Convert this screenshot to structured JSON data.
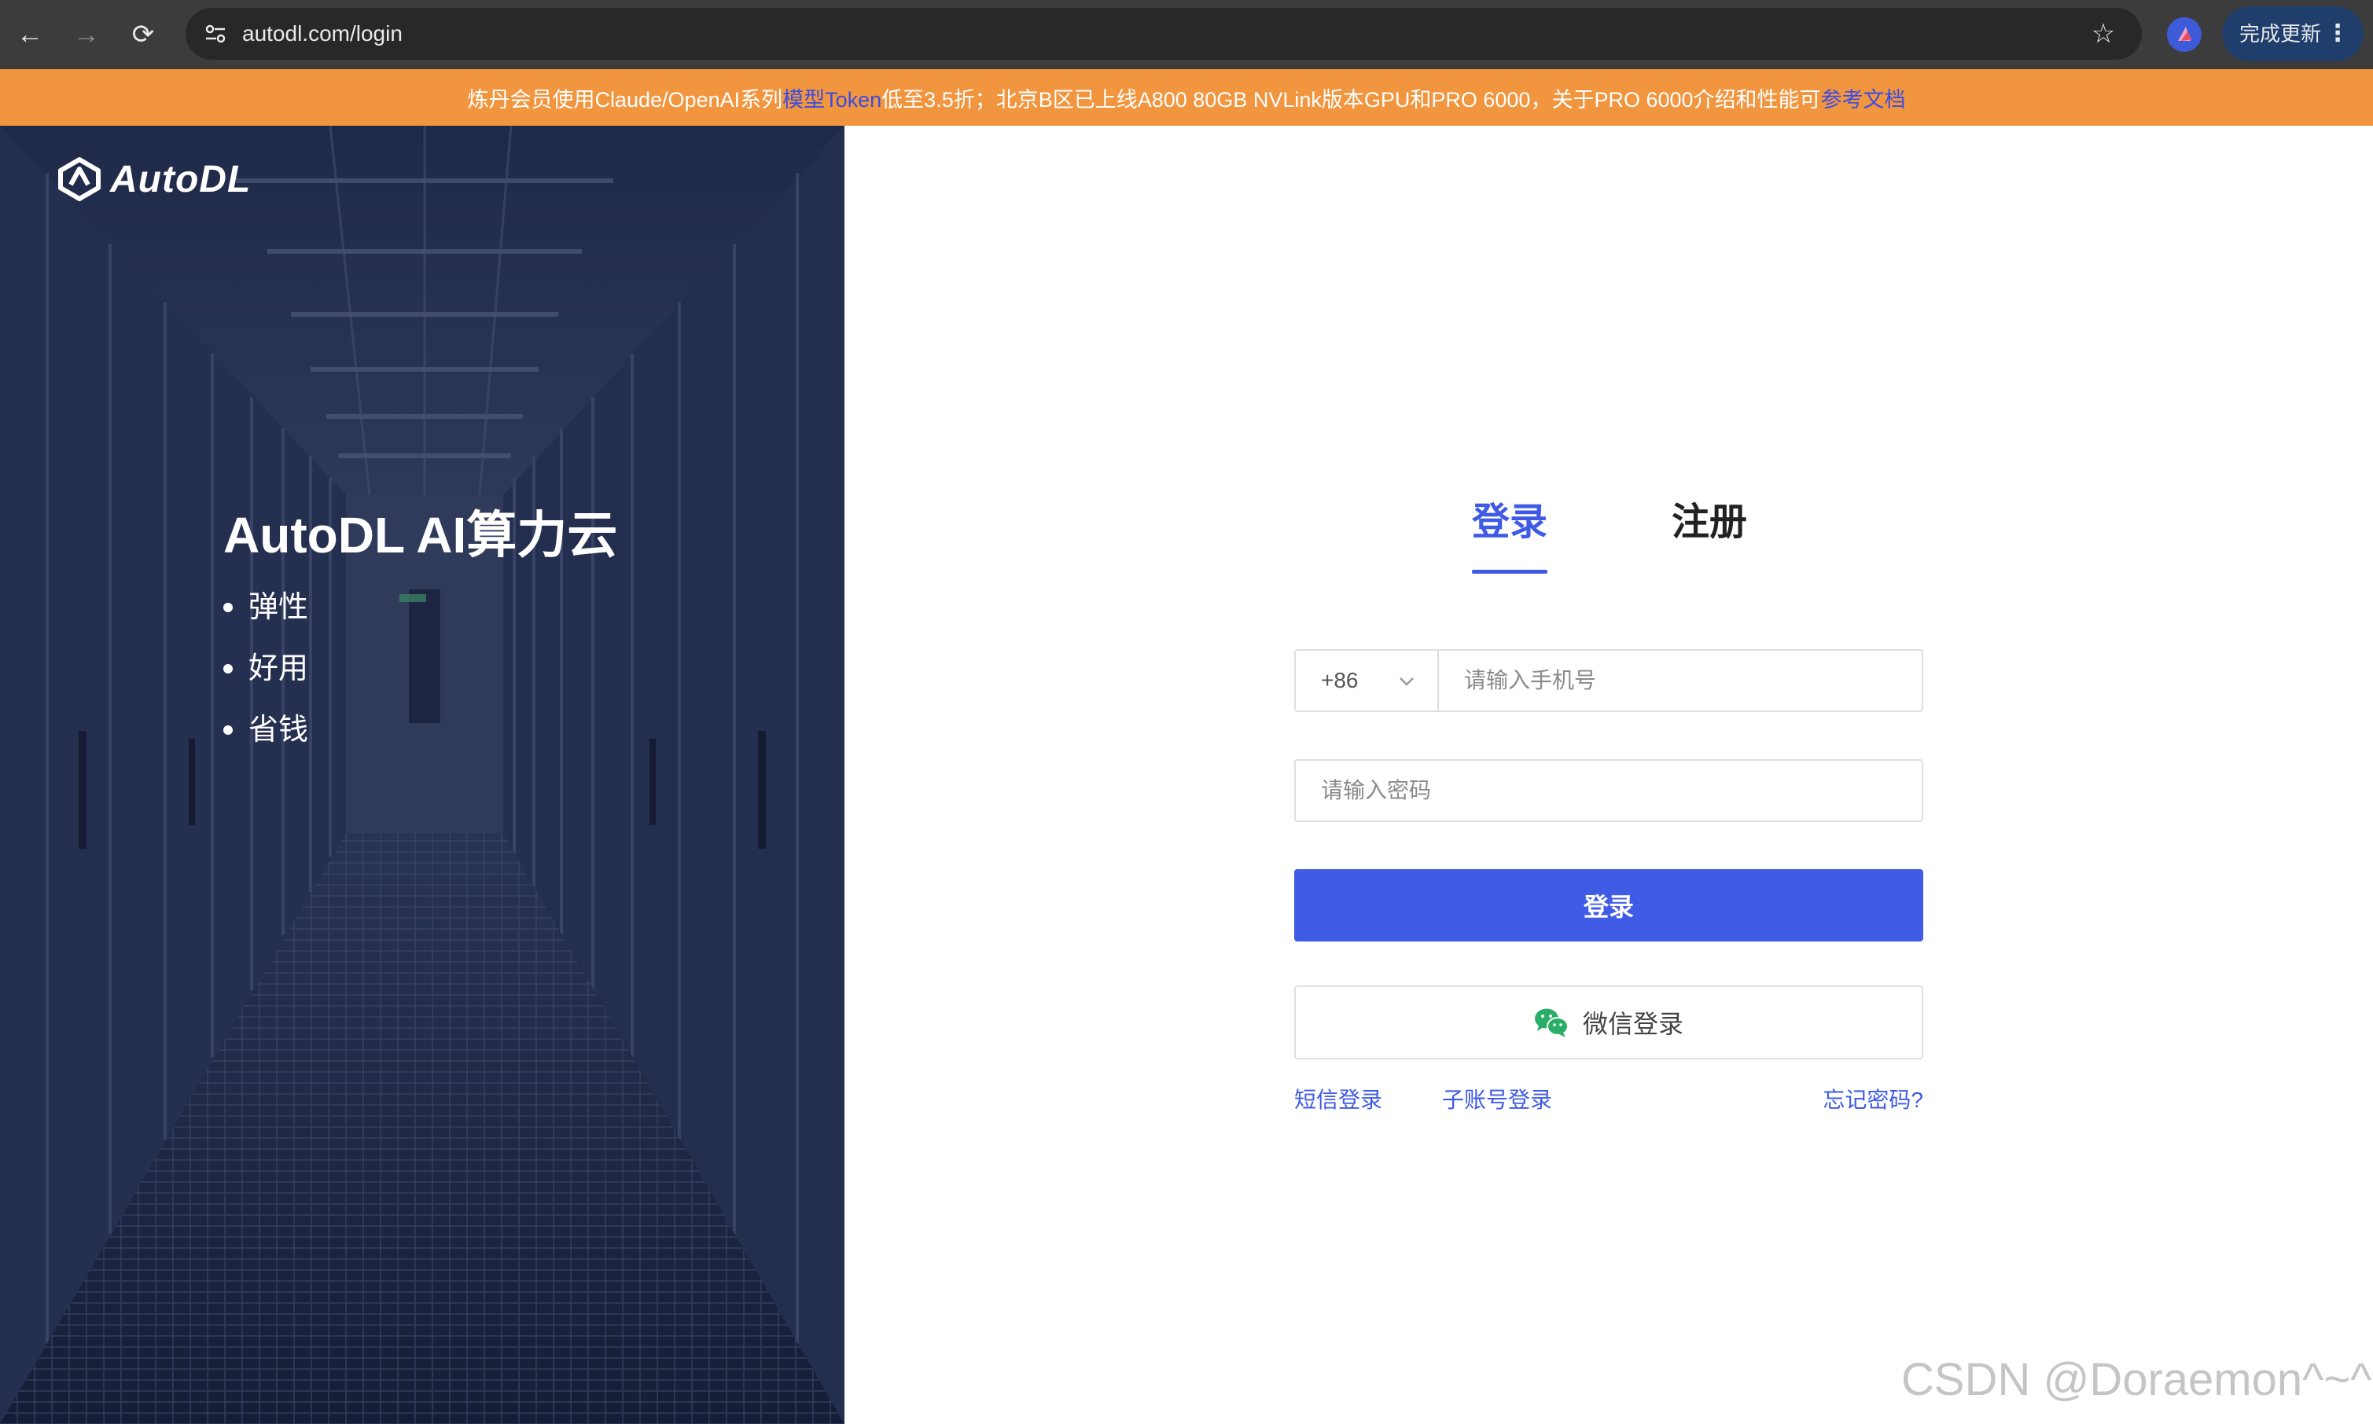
{
  "browser": {
    "url": "autodl.com/login",
    "update_label": "完成更新",
    "menu_glyph": "⋮"
  },
  "banner": {
    "text_before": "炼丹会员使用Claude/OpenAI系列 ",
    "link1": "模型Token",
    "text_middle": " 低至3.5折；北京B区已上线A800 80GB NVLink版本GPU和PRO 6000，关于PRO 6000介绍和性能可 ",
    "link2": "参考文档",
    "bg_color": "#f2953f"
  },
  "hero": {
    "logo_text": "AutoDL",
    "title": "AutoDL AI算力云",
    "features": [
      "弹性",
      "好用",
      "省钱"
    ]
  },
  "tabs": {
    "login": "登录",
    "register": "注册",
    "active": "login"
  },
  "form": {
    "country_code": "+86",
    "phone_placeholder": "请输入手机号",
    "password_placeholder": "请输入密码",
    "login_button": "登录",
    "wechat_button": "微信登录",
    "sms_login": "短信登录",
    "sub_account_login": "子账号登录",
    "forgot_password": "忘记密码?"
  },
  "watermark": "CSDN @Doraemon^~^",
  "colors": {
    "accent": "#405be6",
    "wechat_green": "#2aae67"
  }
}
